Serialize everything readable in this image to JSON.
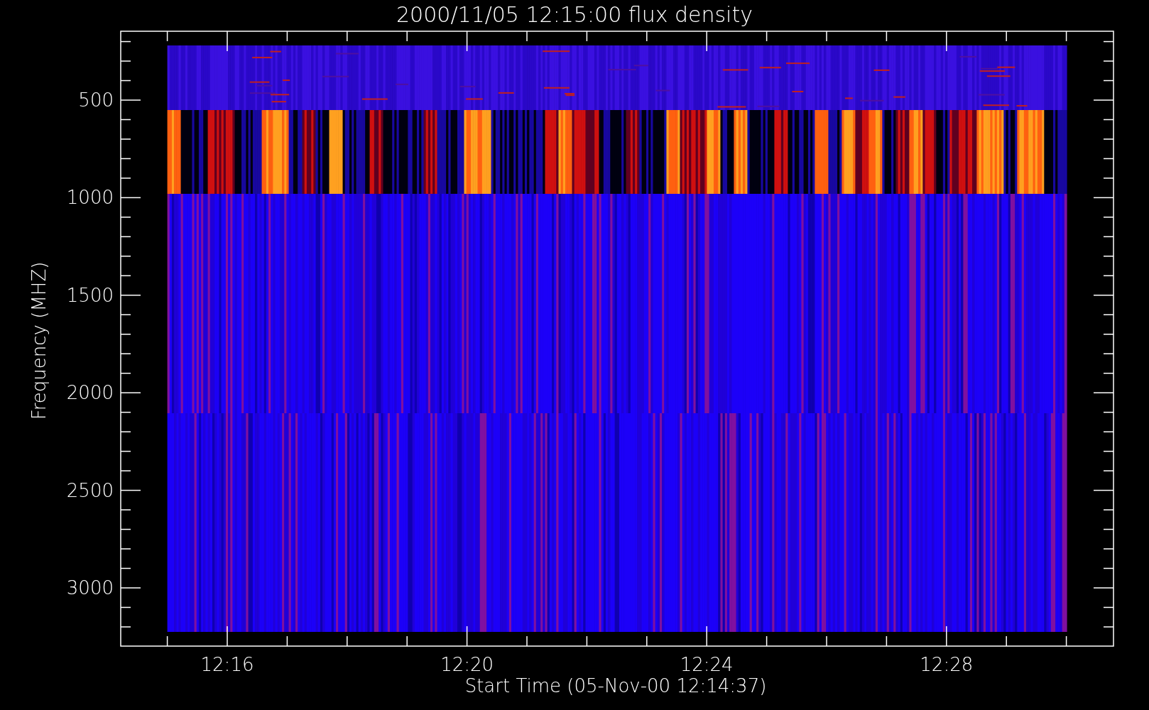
{
  "plot": {
    "title": "2000/11/05 12:15:00 flux density",
    "xlabel": "Start Time (05-Nov-00 12:14:37)",
    "ylabel": "Frequency (MHZ)",
    "xtick_labels": [
      "12:16",
      "12:20",
      "12:24",
      "12:28"
    ],
    "ytick_labels": [
      "500",
      "1000",
      "1500",
      "2000",
      "2500",
      "3000"
    ]
  }
}
